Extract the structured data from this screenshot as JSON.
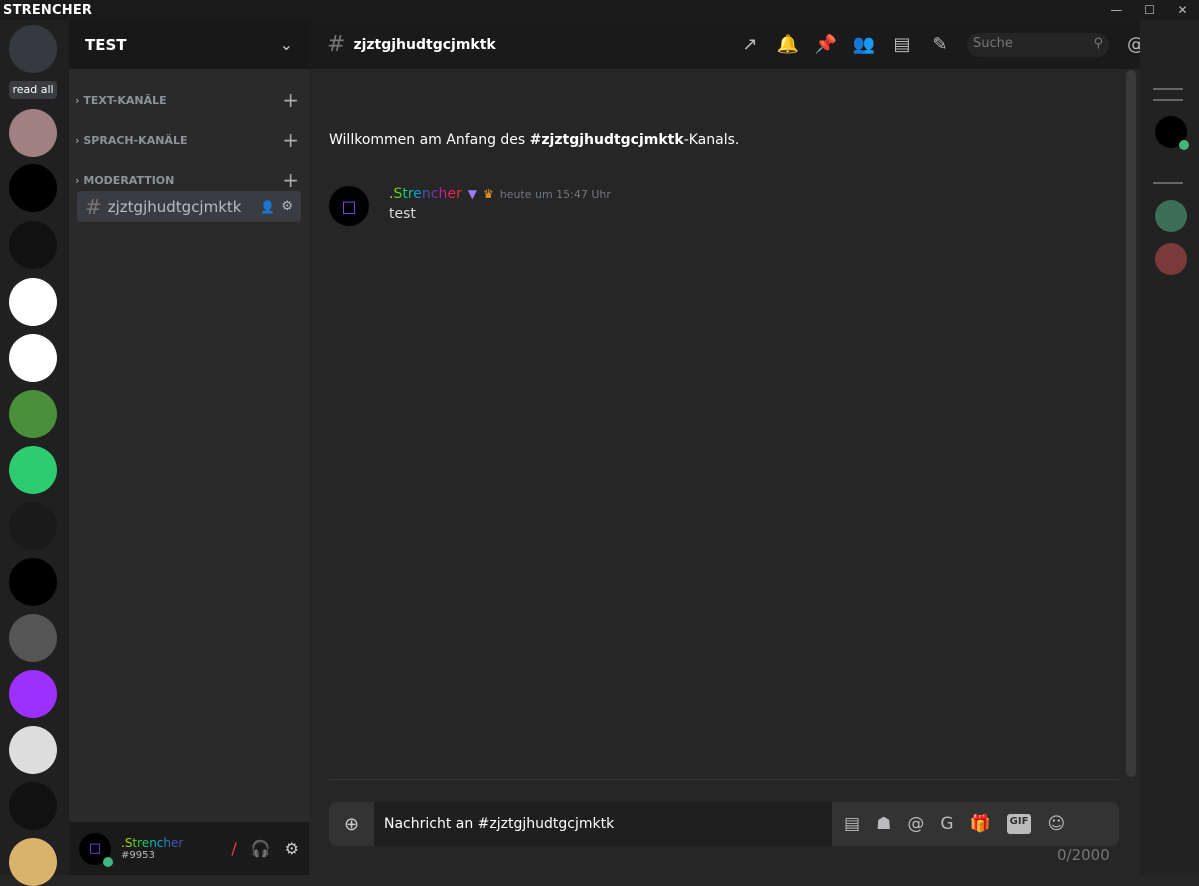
{
  "app": {
    "title": "STRENCHER",
    "window_controls": [
      "minimize",
      "maximize",
      "close"
    ]
  },
  "guilds": {
    "read_all": "read all",
    "items": [
      {
        "name": "discord-home",
        "color": "#36393f"
      },
      {
        "name": "red-eyes-server",
        "color": "#a08080"
      },
      {
        "name": "strencher-twitch",
        "color": "#000000"
      },
      {
        "name": "localhost",
        "color": "#111111"
      },
      {
        "name": "3d-server",
        "color": "#ffffff"
      },
      {
        "name": "3d-server-2",
        "color": "#ffffff"
      },
      {
        "name": "pepe-server",
        "color": "#4a8f3a"
      },
      {
        "name": "sword-server",
        "color": "#2ecc71"
      },
      {
        "name": "s-server",
        "color": "#1a1a1a"
      },
      {
        "name": "strencher-twitch-2",
        "color": "#000000"
      },
      {
        "name": "hs-server",
        "color": "#555555"
      },
      {
        "name": "c-server",
        "color": "#9b30ff"
      },
      {
        "name": "white-server",
        "color": "#dddddd"
      },
      {
        "name": "get-on-my-lvl",
        "color": "#111111"
      },
      {
        "name": "anime-server",
        "color": "#d9b36c"
      }
    ]
  },
  "sidebar": {
    "server_name": "TEST",
    "categories": [
      {
        "label": "TEXT-KANÄLE"
      },
      {
        "label": "SPRACH-KANÄLE"
      },
      {
        "label": "MODERATTION"
      }
    ],
    "channel": {
      "name": "zjztgjhudtgcjmktk"
    }
  },
  "user": {
    "name": ".Strencher",
    "tag": "#9953",
    "status_color": "#43b581"
  },
  "header": {
    "channel": "zjztgjhudtgcjmktk",
    "search_placeholder": "Suche"
  },
  "chat": {
    "welcome_prefix": "Willkommen am Anfang des ",
    "welcome_channel": "#zjztgjhudtgcjmktk",
    "welcome_suffix": "-Kanals.",
    "messages": [
      {
        "author": ".Strencher",
        "timestamp": "heute um 15:47 Uhr",
        "text": "test"
      }
    ]
  },
  "composer": {
    "placeholder": "Nachricht an #zjztgjhudtgcjmktk",
    "counter": "0/2000",
    "gif": "GIF"
  },
  "colors": {
    "accent": "#9147ff",
    "online": "#43b581"
  }
}
